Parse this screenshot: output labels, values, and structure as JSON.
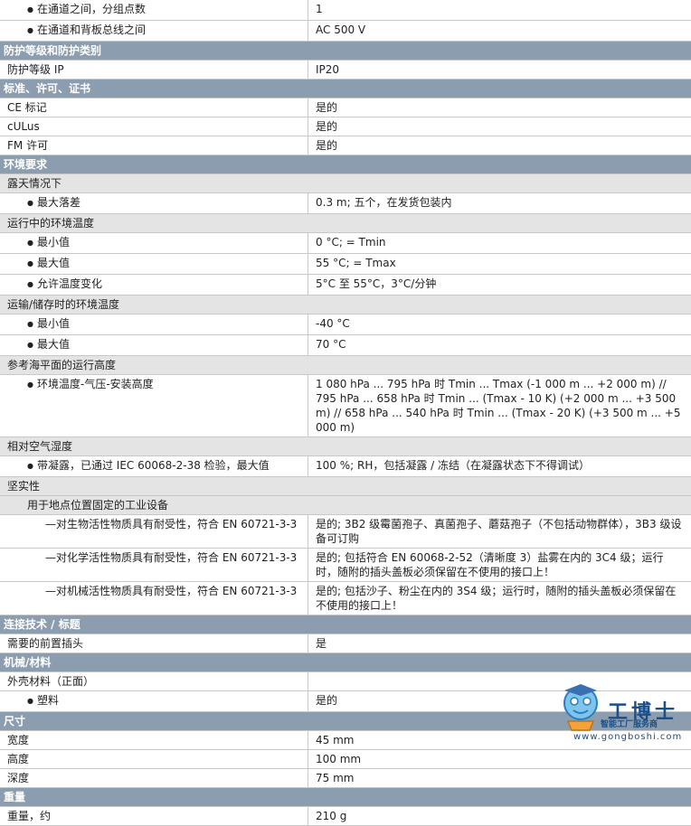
{
  "rows": [
    {
      "type": "bullet",
      "label": "在通道之间，分组点数",
      "value": "1"
    },
    {
      "type": "bullet",
      "label": "在通道和背板总线之间",
      "value": "AC 500 V"
    },
    {
      "type": "sec",
      "label": "防护等级和防护类别"
    },
    {
      "type": "item",
      "label": "防护等级 IP",
      "value": "IP20"
    },
    {
      "type": "sec",
      "label": "标准、许可、证书"
    },
    {
      "type": "item",
      "label": "CE 标记",
      "value": "是的"
    },
    {
      "type": "item",
      "label": "cULus",
      "value": "是的"
    },
    {
      "type": "item",
      "label": "FM 许可",
      "value": "是的"
    },
    {
      "type": "sec",
      "label": "环境要求"
    },
    {
      "type": "sub",
      "label": "露天情况下"
    },
    {
      "type": "bullet",
      "label": "最大落差",
      "value": "0.3 m; 五个，在发货包装内"
    },
    {
      "type": "sub",
      "label": "运行中的环境温度"
    },
    {
      "type": "bullet",
      "label": "最小值",
      "value": "0 °C; = Tmin"
    },
    {
      "type": "bullet",
      "label": "最大值",
      "value": "55 °C; = Tmax"
    },
    {
      "type": "bullet",
      "label": "允许温度变化",
      "value": "5°C 至 55°C，3°C/分钟"
    },
    {
      "type": "sub",
      "label": "运输/储存时的环境温度"
    },
    {
      "type": "bullet",
      "label": "最小值",
      "value": "-40 °C"
    },
    {
      "type": "bullet",
      "label": "最大值",
      "value": "70 °C"
    },
    {
      "type": "sub",
      "label": "参考海平面的运行高度"
    },
    {
      "type": "bullet",
      "label": "环境温度-气压-安装高度",
      "value": "1 080 hPa ... 795 hPa 时 Tmin ... Tmax (-1 000 m ... +2 000 m) // 795 hPa ... 658 hPa 时 Tmin ... (Tmax - 10 K) (+2 000 m ... +3 500 m) // 658 hPa ... 540 hPa 时 Tmin ... (Tmax - 20 K) (+3 500 m ... +5 000 m)"
    },
    {
      "type": "sub",
      "label": "相对空气湿度"
    },
    {
      "type": "bullet",
      "label": "带凝露，已通过 IEC 60068-2-38 检验，最大值",
      "value": "100 %; RH，包括凝露 / 冻结（在凝露状态下不得调试）"
    },
    {
      "type": "sub",
      "label": "坚实性"
    },
    {
      "type": "sub2",
      "label": "用于地点位置固定的工业设备"
    },
    {
      "type": "dash",
      "label": "对生物活性物质具有耐受性，符合 EN 60721-3-3",
      "value": "是的; 3B2 级霉菌孢子、真菌孢子、蘑菇孢子（不包括动物群体），3B3 级设备可订购"
    },
    {
      "type": "dash",
      "label": "对化学活性物质具有耐受性，符合 EN 60721-3-3",
      "value": "是的; 包括符合 EN 60068-2-52（清晰度 3）盐雾在内的 3C4 级；运行时，随附的插头盖板必须保留在不使用的接口上！"
    },
    {
      "type": "dash",
      "label": "对机械活性物质具有耐受性，符合 EN 60721-3-3",
      "value": "是的; 包括沙子、粉尘在内的 3S4 级；运行时，随附的插头盖板必须保留在不使用的接口上！"
    },
    {
      "type": "sec",
      "label": "连接技术 / 标题"
    },
    {
      "type": "item",
      "label": "需要的前置插头",
      "value": "是"
    },
    {
      "type": "sec",
      "label": "机械/材料"
    },
    {
      "type": "item2",
      "label": "外壳材料（正面）",
      "value": ""
    },
    {
      "type": "bullet",
      "label": "塑料",
      "value": "是的"
    },
    {
      "type": "sec",
      "label": "尺寸"
    },
    {
      "type": "item",
      "label": "宽度",
      "value": "45 mm"
    },
    {
      "type": "item",
      "label": "高度",
      "value": "100 mm"
    },
    {
      "type": "item",
      "label": "深度",
      "value": "75 mm"
    },
    {
      "type": "sec",
      "label": "重量"
    },
    {
      "type": "item",
      "label": "重量，约",
      "value": "210 g"
    }
  ],
  "watermark": {
    "brand": "工博士",
    "slogan": "智能工厂服务商",
    "url": "www.gongboshi.com"
  }
}
